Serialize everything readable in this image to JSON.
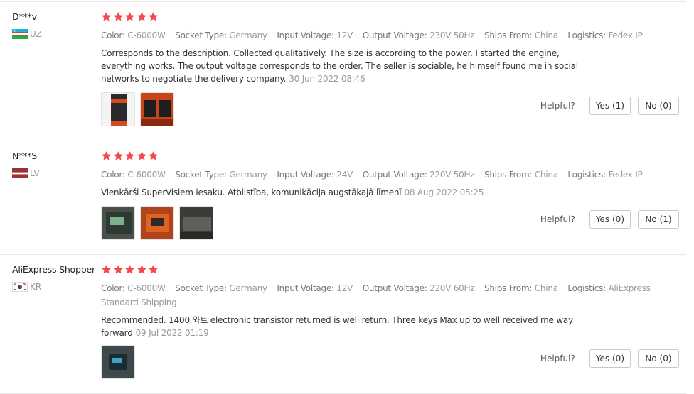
{
  "colors": {
    "star": "#f5484e",
    "accent": "#e62e04"
  },
  "labels": {
    "color": "Color:",
    "socket_type": "Socket Type:",
    "input_voltage": "Input Voltage:",
    "output_voltage": "Output Voltage:",
    "ships_from": "Ships From:",
    "logistics": "Logistics:",
    "helpful": "Helpful?"
  },
  "reviews": [
    {
      "user": "D***v",
      "country": "UZ",
      "rating": 5,
      "color": "C-6000W",
      "socket_type": "Germany",
      "input_voltage": "12V",
      "output_voltage": "230V 50Hz",
      "ships_from": "China",
      "logistics": "Fedex IP",
      "text": "Corresponds to the description. Collected qualitatively. The size is according to the power. I started the engine, everything works. The output voltage corresponds to the order. The seller is sociable, he himself found me in social networks to negotiate the delivery company.",
      "date": "30 Jun 2022 08:46",
      "yes": "Yes (1)",
      "no": "No (0)"
    },
    {
      "user": "N***S",
      "country": "LV",
      "rating": 5,
      "color": "C-6000W",
      "socket_type": "Germany",
      "input_voltage": "24V",
      "output_voltage": "220V 50Hz",
      "ships_from": "China",
      "logistics": "Fedex IP",
      "text": "Vienkārši SuperVisiem iesaku. Atbilstība, komunikācija augstākajā līmenī",
      "date": "08 Aug 2022 05:25",
      "yes": "Yes (0)",
      "no": "No (1)"
    },
    {
      "user": "AliExpress Shopper",
      "country": "KR",
      "rating": 5,
      "color": "C-6000W",
      "socket_type": "Germany",
      "input_voltage": "12V",
      "output_voltage": "220V 60Hz",
      "ships_from": "China",
      "logistics": "AliExpress Standard Shipping",
      "text": "Recommended. 1400 와트 electronic transistor returned is well return. Three keys Max up to well received me way forward",
      "date": "09 Jul 2022 01:19",
      "yes": "Yes (0)",
      "no": "No (0)"
    }
  ]
}
